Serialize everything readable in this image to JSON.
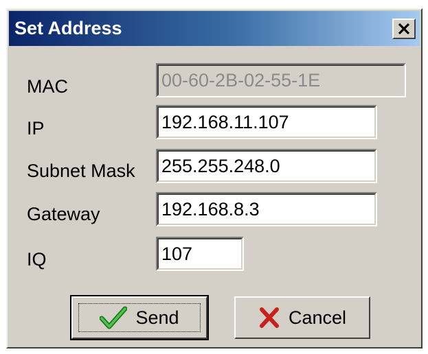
{
  "window": {
    "title": "Set Address",
    "close_label": "×"
  },
  "fields": {
    "mac": {
      "label": "MAC",
      "value": "00-60-2B-02-55-1E",
      "enabled": false
    },
    "ip": {
      "label": "IP",
      "value": "192.168.11.107",
      "enabled": true
    },
    "subnet": {
      "label": "Subnet Mask",
      "value": "255.255.248.0",
      "enabled": true
    },
    "gateway": {
      "label": "Gateway",
      "value": "192.168.8.3",
      "enabled": true
    },
    "iq": {
      "label": "IQ",
      "value": "107",
      "enabled": true
    }
  },
  "buttons": {
    "send": {
      "label": "Send",
      "icon": "checkmark-icon",
      "icon_color": "#2e9a2e"
    },
    "cancel": {
      "label": "Cancel",
      "icon": "x-icon",
      "icon_color": "#c8201a"
    }
  },
  "colors": {
    "title_gradient_start": "#0a246a",
    "title_gradient_end": "#a6caf0",
    "dialog_face": "#d4d0c8"
  }
}
